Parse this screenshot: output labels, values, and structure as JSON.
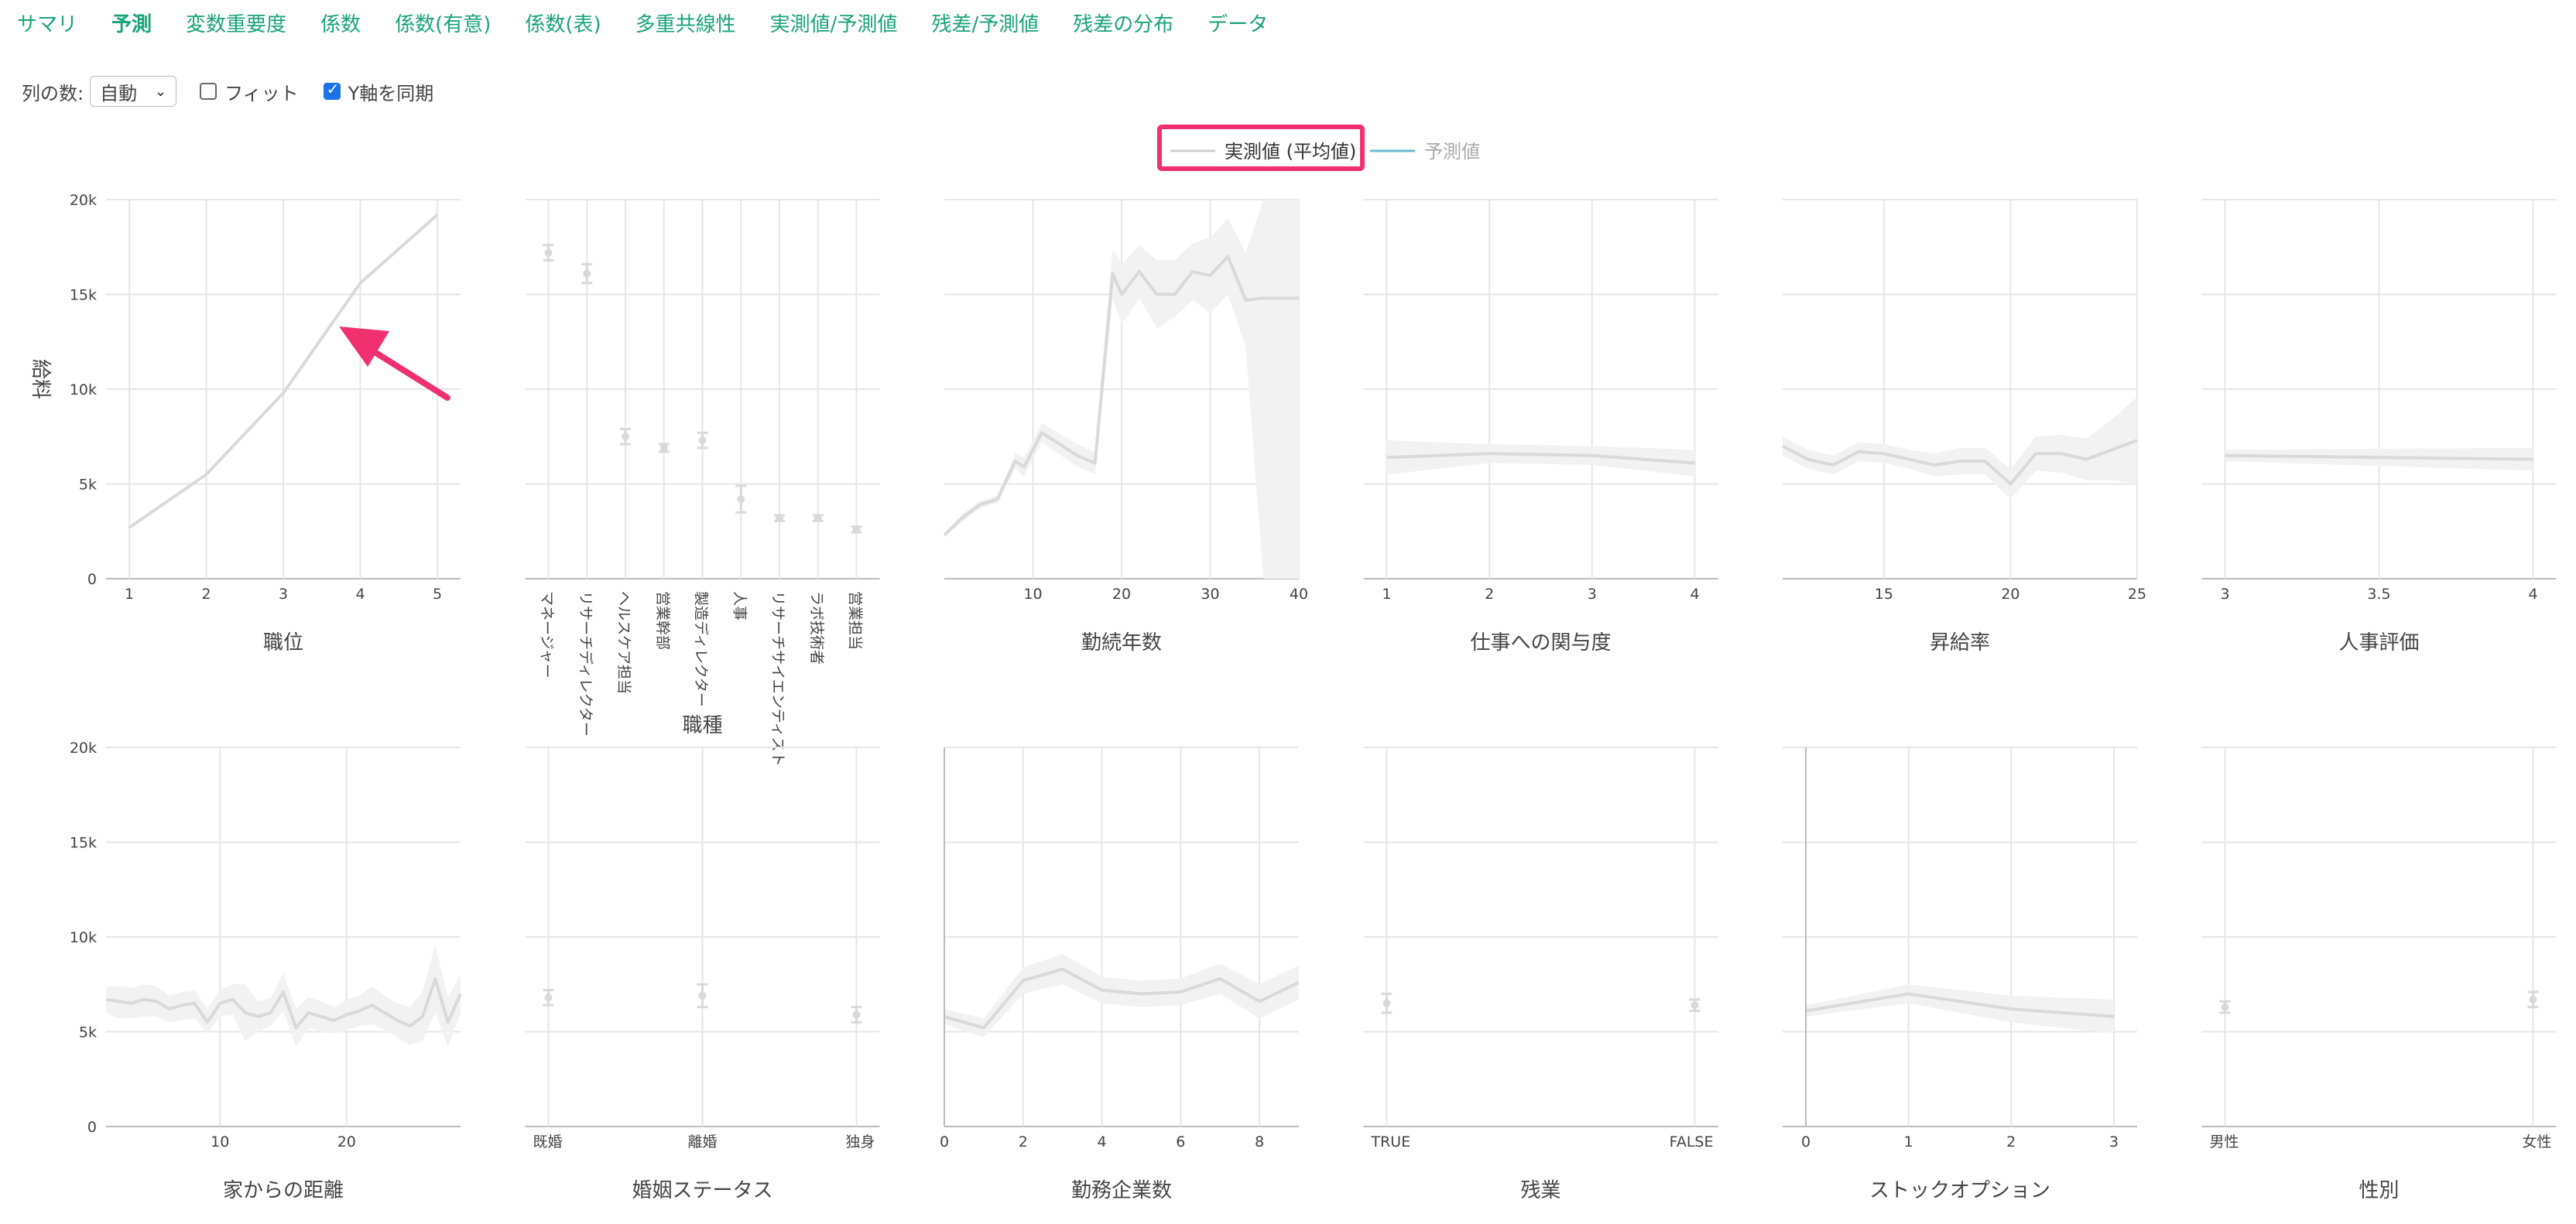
{
  "tabs": [
    {
      "label": "サマリ",
      "active": false
    },
    {
      "label": "予測",
      "active": true
    },
    {
      "label": "変数重要度",
      "active": false
    },
    {
      "label": "係数",
      "active": false
    },
    {
      "label": "係数(有意)",
      "active": false
    },
    {
      "label": "係数(表)",
      "active": false
    },
    {
      "label": "多重共線性",
      "active": false
    },
    {
      "label": "実測値/予測値",
      "active": false
    },
    {
      "label": "残差/予測値",
      "active": false
    },
    {
      "label": "残差の分布",
      "active": false
    },
    {
      "label": "データ",
      "active": false
    }
  ],
  "controls": {
    "columns_label": "列の数:",
    "columns_value": "自動",
    "fit_label": "フィット",
    "fit_checked": false,
    "sync_label": "Y軸を同期",
    "sync_checked": true
  },
  "colors": {
    "accent": "#1aa37a",
    "highlight": "#f0306f",
    "actual": "#d9d9d9",
    "band": "#f2f2f2",
    "predicted": "#6cbcd0",
    "grid": "#e6e6e6"
  },
  "chart_data": {
    "type": "line",
    "ylabel": "給料",
    "ylim": [
      0,
      20000
    ],
    "yticks": [
      0,
      5000,
      10000,
      15000,
      20000
    ],
    "ytick_labels": [
      "0",
      "5k",
      "10k",
      "15k",
      "20k"
    ],
    "legend": [
      {
        "name": "実測値 (平均値)",
        "highlighted": true
      },
      {
        "name": "予測値",
        "highlighted": false
      }
    ],
    "panels": [
      {
        "xlabel": "職位",
        "kind": "line",
        "xlim": [
          1,
          5
        ],
        "xticks": [
          1,
          2,
          3,
          4,
          5
        ],
        "xtick_labels": [
          "1",
          "2",
          "3",
          "4",
          "5"
        ],
        "x": [
          1,
          2,
          3,
          4,
          5
        ],
        "y": [
          2700,
          5500,
          9800,
          15600,
          19200
        ],
        "lo": [
          2700,
          5500,
          9800,
          15600,
          19200
        ],
        "hi": [
          2700,
          5500,
          9800,
          15600,
          19200
        ]
      },
      {
        "xlabel": "職種",
        "kind": "category",
        "categories": [
          "マネージャー",
          "リサーチディレクター",
          "ヘルスケア担当",
          "営業幹部",
          "製造ディレクター",
          "人事",
          "リサーチサイエンティスト",
          "ラボ技術者",
          "営業担当"
        ],
        "y": [
          17200,
          16100,
          7500,
          6900,
          7300,
          4200,
          3200,
          3200,
          2600
        ],
        "lo": [
          16800,
          15600,
          7100,
          6700,
          6900,
          3500,
          3050,
          3050,
          2450
        ],
        "hi": [
          17600,
          16600,
          7900,
          7100,
          7700,
          4900,
          3350,
          3350,
          2750
        ]
      },
      {
        "xlabel": "勤続年数",
        "kind": "line",
        "xlim": [
          0,
          40
        ],
        "xticks": [
          10,
          20,
          30,
          40
        ],
        "xtick_labels": [
          "10",
          "20",
          "30",
          "40"
        ],
        "x": [
          0,
          2,
          4,
          6,
          8,
          9,
          11,
          15,
          17,
          19,
          20,
          22,
          24,
          26,
          28,
          30,
          32,
          34,
          36,
          38,
          40
        ],
        "y": [
          2300,
          3200,
          3900,
          4200,
          6200,
          5900,
          7700,
          6500,
          6100,
          16100,
          15000,
          16200,
          15000,
          15000,
          16200,
          16000,
          17000,
          14700,
          14800,
          14800,
          14800
        ],
        "lo": [
          2200,
          3000,
          3700,
          4000,
          5800,
          5400,
          7200,
          5900,
          5500,
          14800,
          13400,
          14800,
          13200,
          13800,
          14700,
          14000,
          15000,
          12200,
          0,
          0,
          0
        ],
        "hi": [
          2400,
          3400,
          4100,
          4400,
          6600,
          6400,
          8200,
          7100,
          6700,
          17400,
          16600,
          17600,
          16800,
          16800,
          17700,
          18000,
          19000,
          17200,
          20000,
          20000,
          20000
        ]
      },
      {
        "xlabel": "仕事への関与度",
        "kind": "line",
        "xlim": [
          1,
          4
        ],
        "xticks": [
          1,
          2,
          3,
          4
        ],
        "xtick_labels": [
          "1",
          "2",
          "3",
          "4"
        ],
        "x": [
          1,
          2,
          3,
          4
        ],
        "y": [
          6400,
          6600,
          6500,
          6100
        ],
        "lo": [
          5500,
          6100,
          6000,
          5400
        ],
        "hi": [
          7300,
          7100,
          7000,
          6800
        ]
      },
      {
        "xlabel": "昇給率",
        "kind": "line",
        "xlim": [
          11,
          25
        ],
        "xticks": [
          15,
          20,
          25
        ],
        "xtick_labels": [
          "15",
          "20",
          "25"
        ],
        "x": [
          11,
          12,
          13,
          14,
          15,
          16,
          17,
          18,
          19,
          20,
          21,
          22,
          23,
          24,
          25
        ],
        "y": [
          7000,
          6300,
          6000,
          6700,
          6600,
          6300,
          6000,
          6200,
          6200,
          5000,
          6600,
          6600,
          6300,
          6800,
          7300
        ],
        "lo": [
          6500,
          5800,
          5500,
          6200,
          6100,
          5800,
          5400,
          5500,
          5500,
          4200,
          5700,
          5600,
          5200,
          5200,
          5000
        ],
        "hi": [
          7500,
          6800,
          6500,
          7200,
          7100,
          6800,
          6600,
          6900,
          6900,
          5800,
          7500,
          7600,
          7400,
          8400,
          9600
        ]
      },
      {
        "xlabel": "人事評価",
        "kind": "line",
        "xlim": [
          3,
          4
        ],
        "xticks": [
          3,
          3.5,
          4
        ],
        "xtick_labels": [
          "3",
          "3.5",
          "4"
        ],
        "x": [
          3,
          4
        ],
        "y": [
          6500,
          6300
        ],
        "lo": [
          6200,
          5700
        ],
        "hi": [
          6800,
          6900
        ]
      },
      {
        "xlabel": "家からの距離",
        "kind": "line",
        "xlim": [
          1,
          29
        ],
        "xticks": [
          10,
          20
        ],
        "xtick_labels": [
          "10",
          "20"
        ],
        "x": [
          1,
          2,
          3,
          4,
          5,
          6,
          7,
          8,
          9,
          10,
          11,
          12,
          13,
          14,
          15,
          16,
          17,
          18,
          19,
          20,
          21,
          22,
          23,
          24,
          25,
          26,
          27,
          28,
          29
        ],
        "y": [
          6700,
          6600,
          6500,
          6700,
          6600,
          6200,
          6400,
          6500,
          5500,
          6500,
          6700,
          6000,
          5800,
          6000,
          7100,
          5200,
          6000,
          5800,
          5600,
          5900,
          6100,
          6400,
          6000,
          5600,
          5300,
          5800,
          7800,
          5500,
          7000
        ],
        "lo": [
          6000,
          5700,
          5700,
          5800,
          5800,
          5500,
          5600,
          5700,
          4900,
          5800,
          5900,
          4500,
          5000,
          5300,
          6100,
          4200,
          5200,
          5000,
          4900,
          5100,
          5300,
          5400,
          5100,
          4700,
          4300,
          4500,
          6000,
          4200,
          6000
        ],
        "hi": [
          7400,
          7400,
          7300,
          7500,
          7400,
          6900,
          7100,
          7200,
          6200,
          7200,
          7500,
          7500,
          6600,
          6800,
          8100,
          6200,
          6800,
          6600,
          6300,
          6700,
          6900,
          7400,
          6900,
          6500,
          6300,
          7100,
          9600,
          6800,
          8000
        ]
      },
      {
        "xlabel": "婚姻ステータス",
        "kind": "category",
        "categories": [
          "既婚",
          "離婚",
          "独身"
        ],
        "y": [
          6800,
          6900,
          5900
        ],
        "lo": [
          6400,
          6300,
          5500
        ],
        "hi": [
          7200,
          7500,
          6300
        ]
      },
      {
        "xlabel": "勤務企業数",
        "kind": "line",
        "xlim": [
          0,
          9
        ],
        "xticks": [
          0,
          2,
          4,
          6,
          8
        ],
        "xtick_labels": [
          "0",
          "2",
          "4",
          "6",
          "8"
        ],
        "x": [
          0,
          1,
          2,
          3,
          4,
          5,
          6,
          7,
          8,
          9
        ],
        "y": [
          5800,
          5200,
          7700,
          8300,
          7200,
          7000,
          7100,
          7800,
          6600,
          7600
        ],
        "lo": [
          5400,
          4700,
          7000,
          7500,
          6500,
          6300,
          6400,
          7000,
          5700,
          6700
        ],
        "hi": [
          6200,
          5700,
          8400,
          9100,
          7900,
          7700,
          7800,
          8600,
          7500,
          8500
        ]
      },
      {
        "xlabel": "残業",
        "kind": "category",
        "categories": [
          "TRUE",
          "FALSE"
        ],
        "y": [
          6500,
          6400
        ],
        "lo": [
          6000,
          6100
        ],
        "hi": [
          7000,
          6700
        ]
      },
      {
        "xlabel": "ストックオプション",
        "kind": "line",
        "xlim": [
          0,
          3
        ],
        "xticks": [
          0,
          1,
          2,
          3
        ],
        "xtick_labels": [
          "0",
          "1",
          "2",
          "3"
        ],
        "x": [
          0,
          1,
          2,
          3
        ],
        "y": [
          6100,
          7000,
          6200,
          5800
        ],
        "lo": [
          5800,
          6500,
          5500,
          4900
        ],
        "hi": [
          6400,
          7500,
          6900,
          6700
        ]
      },
      {
        "xlabel": "性別",
        "kind": "category",
        "categories": [
          "男性",
          "女性"
        ],
        "y": [
          6300,
          6700
        ],
        "lo": [
          6000,
          6300
        ],
        "hi": [
          6600,
          7100
        ]
      }
    ]
  }
}
